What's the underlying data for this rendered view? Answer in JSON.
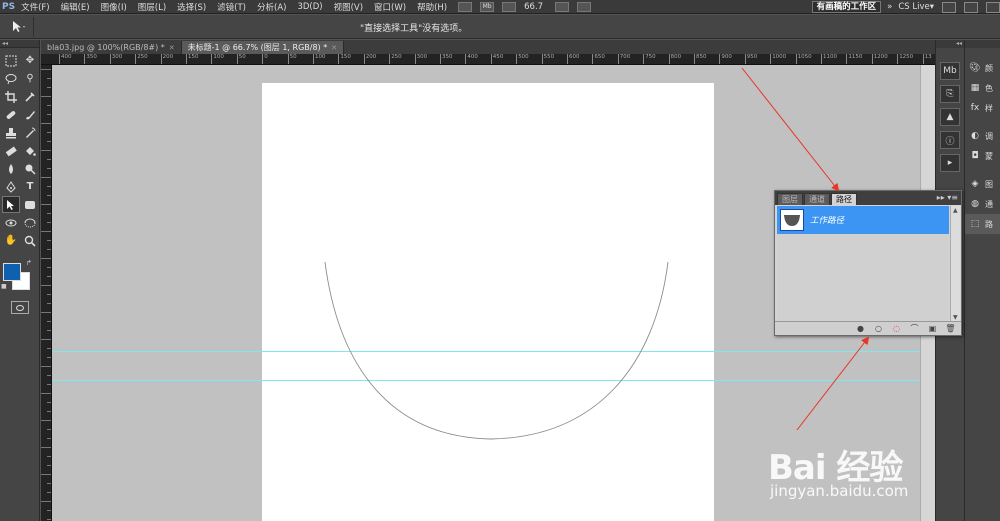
{
  "app": {
    "logo": "PS"
  },
  "menu": [
    "文件(F)",
    "编辑(E)",
    "图像(I)",
    "图层(L)",
    "选择(S)",
    "滤镜(T)",
    "分析(A)",
    "3D(D)",
    "视图(V)",
    "窗口(W)",
    "帮助(H)"
  ],
  "menubar_right": {
    "mb_label": "Mb",
    "zoom": "66.7",
    "workspace": "有画稿的工作区",
    "expand": "»",
    "cslive": "CS Live▾"
  },
  "options": {
    "tool_icon": "direct-select-arrow",
    "message": "\"直接选择工具\"没有选项。"
  },
  "doc_tabs": [
    {
      "label": "bla03.jpg @ 100%(RGB/8#) *",
      "active": false
    },
    {
      "label": "未标题-1 @ 66.7% (图层 1, RGB/8) *",
      "active": true
    }
  ],
  "ruler_labels": [
    "400",
    "350",
    "300",
    "250",
    "200",
    "150",
    "100",
    "50",
    "0",
    "50",
    "100",
    "150",
    "200",
    "250",
    "300",
    "350",
    "400",
    "450",
    "500",
    "550",
    "600",
    "650",
    "700",
    "750",
    "800",
    "850",
    "900",
    "950",
    "1000",
    "1050",
    "1100",
    "1150",
    "1200",
    "1250",
    "13"
  ],
  "paths_panel": {
    "tabs": [
      "图层",
      "通道",
      "路径"
    ],
    "active_tab": "路径",
    "menu_icon": "▸▸ ▾≡",
    "item_label": "工作路径",
    "footer_buttons": [
      "fill-path",
      "stroke-path",
      "load-as-selection",
      "make-work-path",
      "new-path",
      "delete-path"
    ],
    "highlighted_button": "load-as-selection"
  },
  "dock_panel": {
    "collapse": "◂◂",
    "group1": [
      "颜",
      "色",
      "样"
    ],
    "group2": [
      "调",
      "蒙"
    ],
    "group3": [
      "图",
      "通",
      "路"
    ]
  },
  "watermark": {
    "brand": "Bai  经验",
    "url": "jingyan.baidu.com"
  },
  "colors": {
    "foreground": "#1060b0",
    "background": "#ffffff",
    "guide": "#7ee8ee",
    "selection": "#3c95f2",
    "annotation": "#e8342a"
  }
}
